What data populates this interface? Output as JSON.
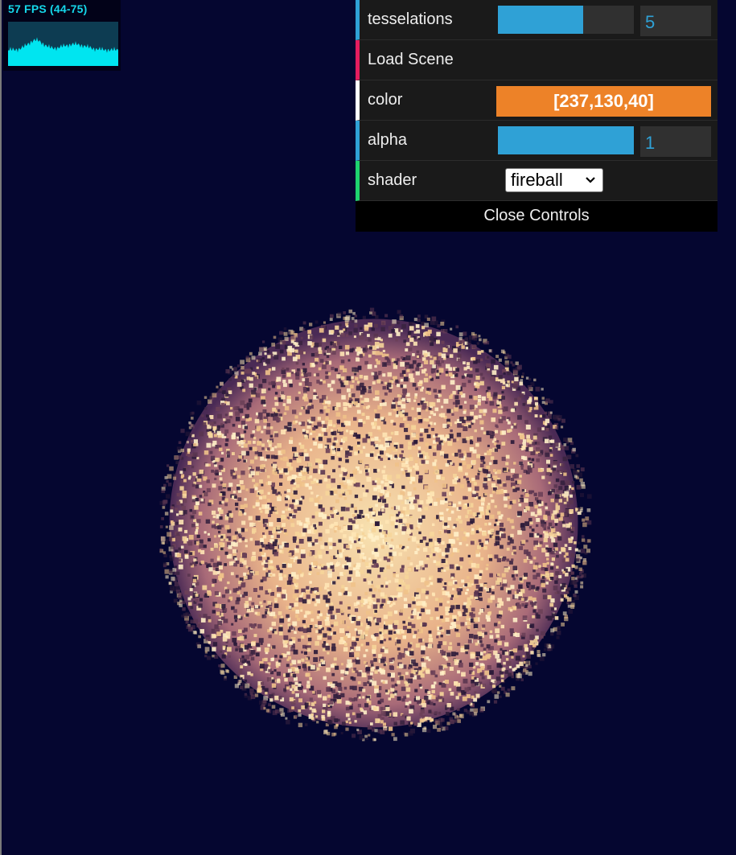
{
  "stats": {
    "fps_text": "57 FPS (44-75)",
    "graph_color": "#00e5f0"
  },
  "gui": {
    "tesselations": {
      "label": "tesselations",
      "value": "5",
      "fraction": 0.63
    },
    "load_scene": {
      "label": "Load Scene"
    },
    "color": {
      "label": "color",
      "value": "[237,130,40]",
      "hex": "#ed8228"
    },
    "alpha": {
      "label": "alpha",
      "value": "1",
      "fraction": 1.0
    },
    "shader": {
      "label": "shader",
      "selected": "fireball"
    },
    "close_label": "Close Controls"
  },
  "colors": {
    "background": "#050630",
    "accent_number": "#2fa1d6",
    "accent_function": "#e61d5f",
    "accent_option": "#1ed36f",
    "fireball_core": "#f6d59a",
    "fireball_edge": "#8a4a6a"
  }
}
